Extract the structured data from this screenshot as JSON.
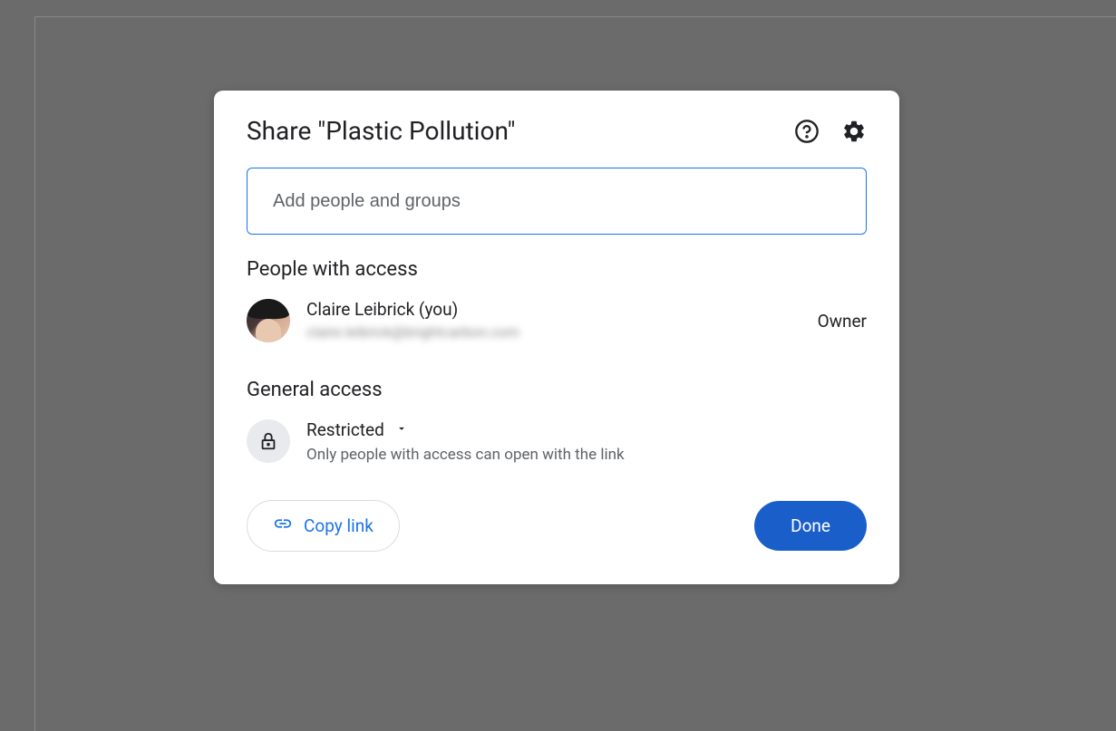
{
  "dialog": {
    "title": "Share \"Plastic Pollution\"",
    "input_placeholder": "Add people and groups"
  },
  "people": {
    "section_title": "People with access",
    "items": [
      {
        "name": "Claire Leibrick (you)",
        "email": "claire.leibrick@brightcarbon.com",
        "role": "Owner"
      }
    ]
  },
  "general": {
    "section_title": "General access",
    "mode": "Restricted",
    "description": "Only people with access can open with the link"
  },
  "footer": {
    "copy_link": "Copy link",
    "done": "Done"
  }
}
